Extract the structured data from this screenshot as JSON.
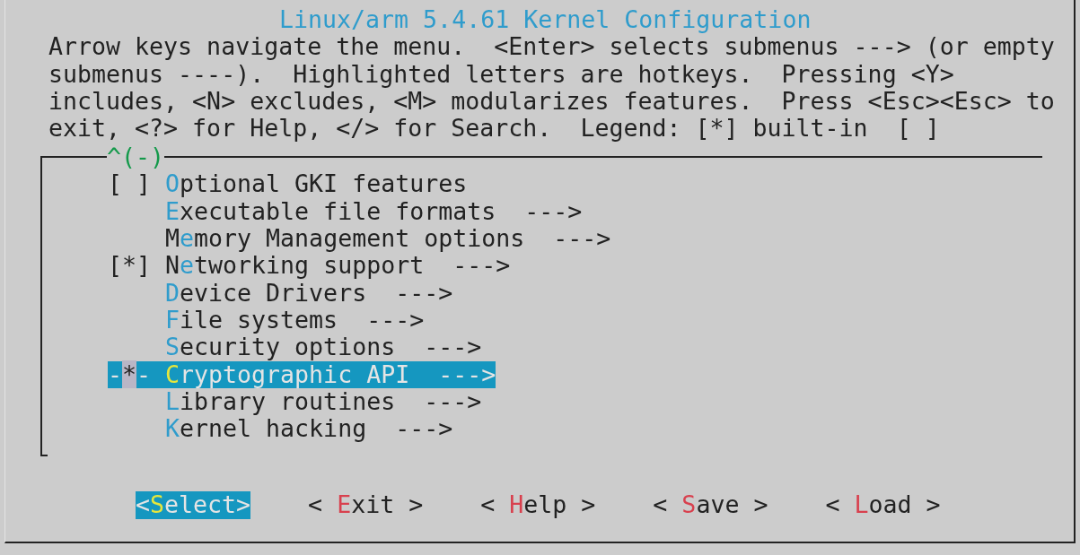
{
  "window": {
    "title": "Linux/arm 5.4.61 Kernel Configuration"
  },
  "help_text": [
    "Arrow keys navigate the menu.  <Enter> selects submenus ---> (or empty",
    "submenus ----).  Highlighted letters are hotkeys.  Pressing <Y>",
    "includes, <N> excludes, <M> modularizes features.  Press <Esc><Esc> to",
    "exit, <?> for Help, </> for Search.  Legend: [*] built-in  [ ]"
  ],
  "menu": {
    "scroll_indicator": "^(-)",
    "items": [
      {
        "prefix": "[ ]",
        "hotkey": "O",
        "rest": "ptional GKI features",
        "selected": false
      },
      {
        "hotkey": "E",
        "rest": "xecutable file formats",
        "submenu": "--->",
        "selected": false
      },
      {
        "lead": "M",
        "hotkey": "e",
        "rest": "mory Management options",
        "submenu": "--->",
        "selected": false
      },
      {
        "prefix": "[*]",
        "lead": "N",
        "hotkey": "e",
        "rest": "tworking support",
        "submenu": "--->",
        "selected": false
      },
      {
        "hotkey": "D",
        "rest": "evice Drivers",
        "submenu": "--->",
        "selected": false
      },
      {
        "hotkey": "F",
        "rest": "ile systems",
        "submenu": "--->",
        "selected": false
      },
      {
        "hotkey": "S",
        "rest": "ecurity options",
        "submenu": "--->",
        "selected": false
      },
      {
        "prefix": "-*-",
        "hotkey": "C",
        "rest": "ryptographic API",
        "submenu": "--->",
        "selected": true
      },
      {
        "hotkey": "L",
        "rest": "ibrary routines",
        "submenu": "--->",
        "selected": false
      },
      {
        "hotkey": "K",
        "rest": "ernel hacking",
        "submenu": "--->",
        "selected": false
      }
    ]
  },
  "buttons": [
    {
      "before": "<",
      "hotkey": "S",
      "after": "elect>",
      "selected": true
    },
    {
      "before": "< ",
      "hotkey": "E",
      "after": "xit >",
      "selected": false
    },
    {
      "before": "< ",
      "hotkey": "H",
      "after": "elp >",
      "selected": false
    },
    {
      "before": "< ",
      "hotkey": "S",
      "after": "ave >",
      "selected": false
    },
    {
      "before": "< ",
      "hotkey": "L",
      "after": "oad >",
      "selected": false
    }
  ]
}
